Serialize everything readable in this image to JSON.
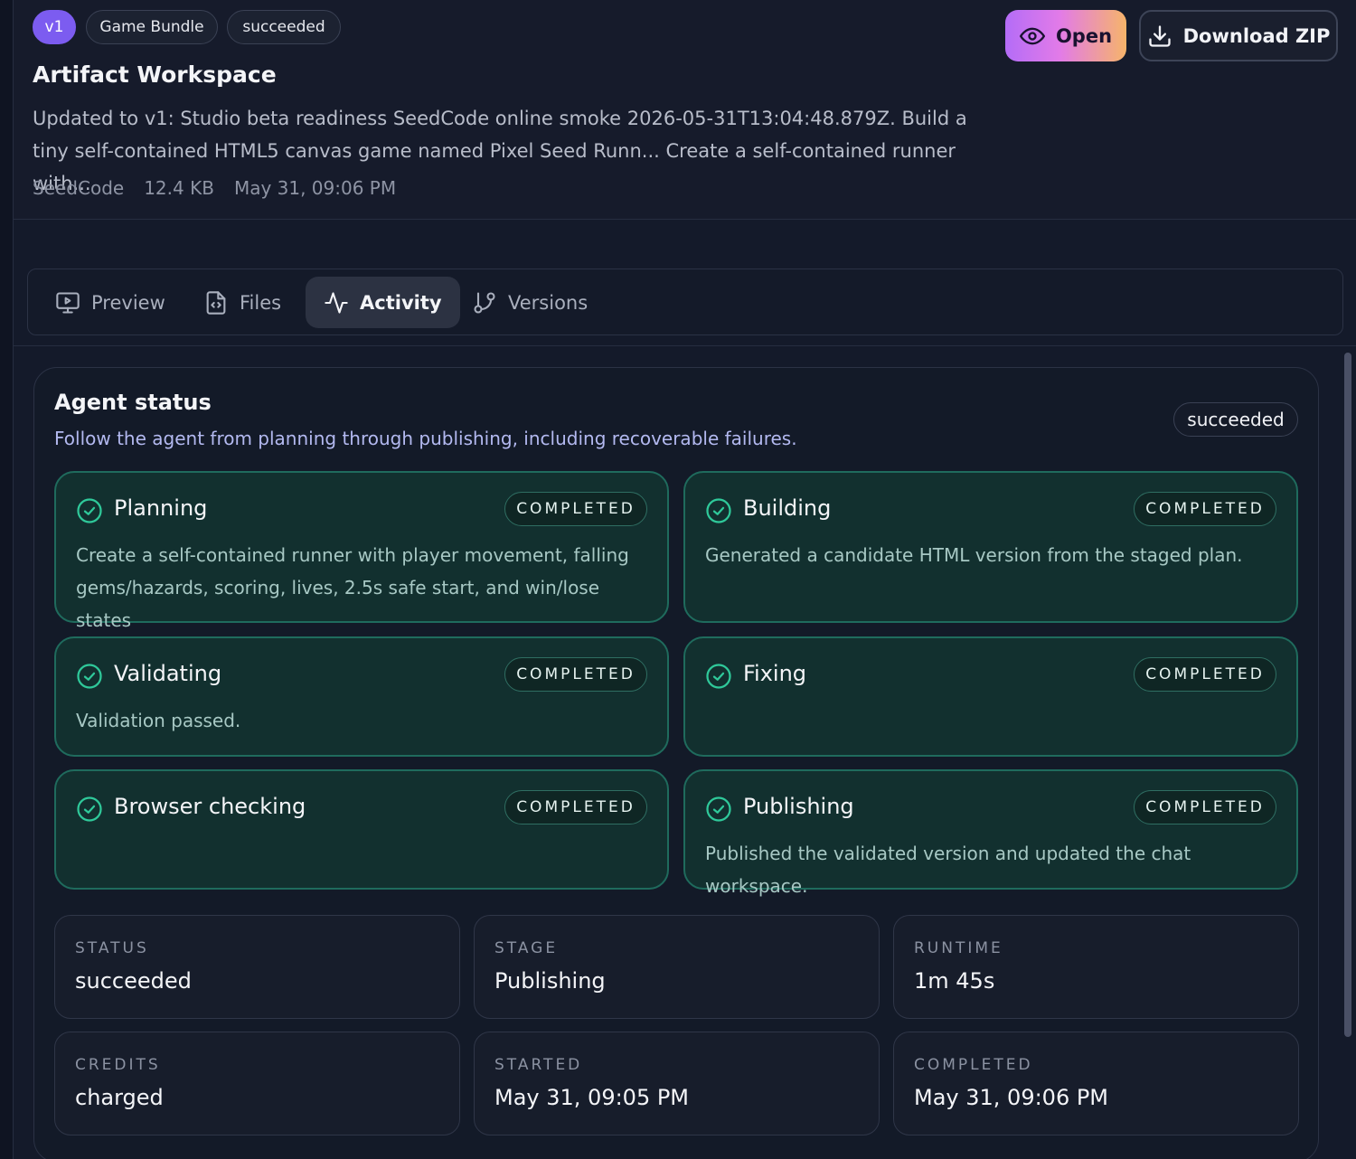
{
  "header": {
    "version_badge": "v1",
    "kind_badge": "Game Bundle",
    "status_badge": "succeeded",
    "open_label": "Open",
    "download_label": "Download ZIP",
    "title": "Artifact Workspace",
    "description": "Updated to v1: Studio beta readiness SeedCode online smoke 2026-05-31T13:04:48.879Z. Build a tiny self-contained HTML5 canvas game named Pixel Seed Runn... Create a self-contained runner with...",
    "meta": {
      "source": "SeedCode",
      "size": "12.4 KB",
      "date": "May 31, 09:06 PM"
    }
  },
  "tabs": [
    {
      "label": "Preview",
      "icon": "monitor-play-icon",
      "active": false
    },
    {
      "label": "Files",
      "icon": "file-code-icon",
      "active": false
    },
    {
      "label": "Activity",
      "icon": "activity-icon",
      "active": true
    },
    {
      "label": "Versions",
      "icon": "git-branch-icon",
      "active": false
    }
  ],
  "agent": {
    "title": "Agent status",
    "subtitle": "Follow the agent from planning through publishing, including recoverable failures.",
    "status": "succeeded",
    "stages": [
      {
        "name": "Planning",
        "status": "COMPLETED",
        "body": "Create a self-contained runner with player movement, falling gems/hazards, scoring, lives, 2.5s safe start, and win/lose states"
      },
      {
        "name": "Building",
        "status": "COMPLETED",
        "body": "Generated a candidate HTML version from the staged plan."
      },
      {
        "name": "Validating",
        "status": "COMPLETED",
        "body": "Validation passed."
      },
      {
        "name": "Fixing",
        "status": "COMPLETED",
        "body": ""
      },
      {
        "name": "Browser checking",
        "status": "COMPLETED",
        "body": ""
      },
      {
        "name": "Publishing",
        "status": "COMPLETED",
        "body": "Published the validated version and updated the chat workspace."
      }
    ],
    "stats": [
      {
        "label": "STATUS",
        "value": "succeeded"
      },
      {
        "label": "STAGE",
        "value": "Publishing"
      },
      {
        "label": "RUNTIME",
        "value": "1m 45s"
      },
      {
        "label": "CREDITS",
        "value": "charged"
      },
      {
        "label": "STARTED",
        "value": "May 31, 09:05 PM"
      },
      {
        "label": "COMPLETED",
        "value": "May 31, 09:06 PM"
      }
    ]
  },
  "colors": {
    "accent_purple": "#7c5cf0",
    "stage_border": "#1f6b5d",
    "check_green": "#2fc99a"
  }
}
